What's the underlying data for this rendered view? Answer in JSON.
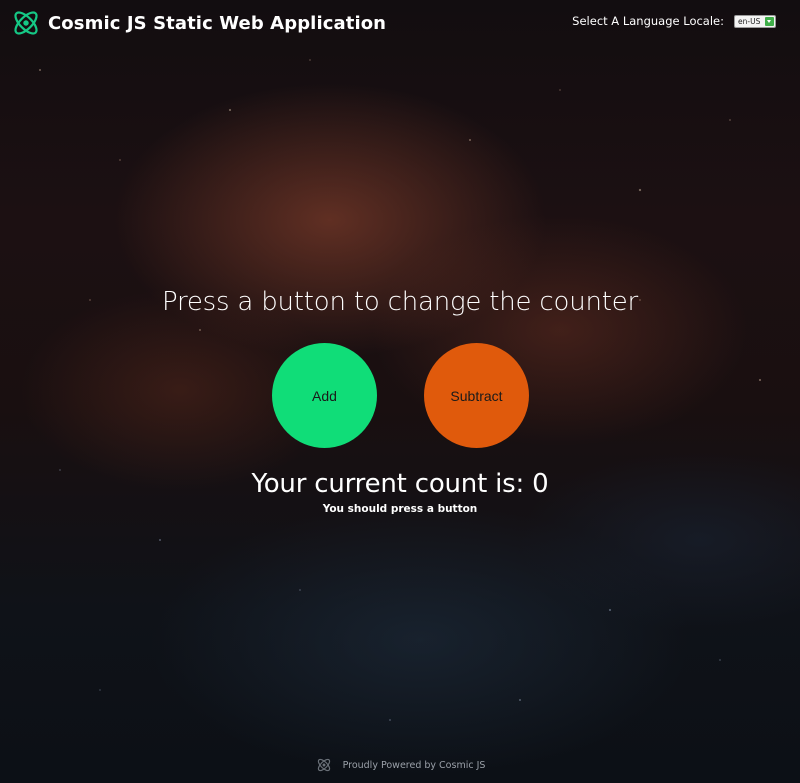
{
  "header": {
    "title": "Cosmic JS Static Web Application",
    "logo_icon": "cosmic-js-logo-icon",
    "locale_label": "Select A Language Locale:",
    "locale_value": "en-US"
  },
  "main": {
    "prompt": "Press a button to change the counter",
    "add_label": "Add",
    "subtract_label": "Subtract",
    "count_text": "Your current count is: 0",
    "count": 0,
    "hint": "You should press a button"
  },
  "footer": {
    "text": "Proudly Powered by Cosmic JS",
    "logo_icon": "cosmic-js-logo-icon"
  },
  "colors": {
    "logo_accent": "#15c885",
    "add_button": "#10dd78",
    "subtract_button": "#e05a0c",
    "text": "#ffffff"
  }
}
